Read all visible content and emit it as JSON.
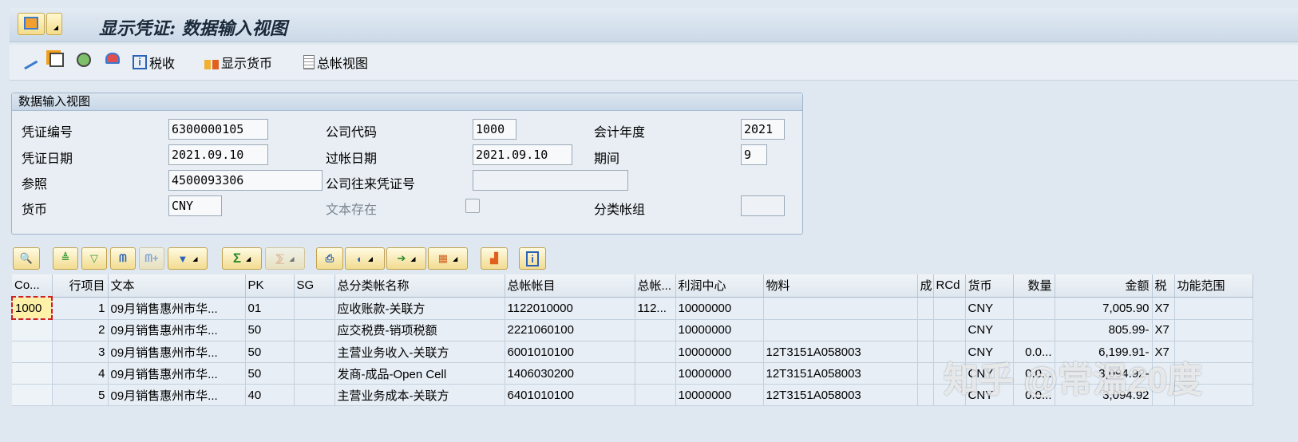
{
  "title": "显示凭证: 数据输入视图",
  "toolbar": {
    "tax": "税收",
    "display_currency": "显示货币",
    "gl_view": "总帐视图"
  },
  "panel": {
    "header": "数据输入视图",
    "doc_no_label": "凭证编号",
    "doc_no": "6300000105",
    "company_label": "公司代码",
    "company": "1000",
    "fiscal_year_label": "会计年度",
    "fiscal_year": "2021",
    "doc_date_label": "凭证日期",
    "doc_date": "2021.09.10",
    "post_date_label": "过帐日期",
    "post_date": "2021.09.10",
    "period_label": "期间",
    "period": "9",
    "ref_label": "参照",
    "ref": "4500093306",
    "intercompany_label": "公司往来凭证号",
    "intercompany": "",
    "currency_label": "货币",
    "currency": "CNY",
    "text_exists_label": "文本存在",
    "ledger_group_label": "分类帐组",
    "ledger_group": ""
  },
  "grid": {
    "columns": [
      "Co...",
      "行项目",
      "文本",
      "PK",
      "SG",
      "总分类帐名称",
      "总帐帐目",
      "总帐...",
      "利润中心",
      "物料",
      "成",
      "RCd",
      "货币",
      "数量",
      "金额",
      "税",
      "功能范围"
    ],
    "rows": [
      [
        "1000",
        "1",
        "09月销售惠州市华...",
        "01",
        "",
        "应收账款-关联方",
        "1122010000",
        "112...",
        "10000000",
        "",
        "",
        "",
        "CNY",
        "",
        "7,005.90",
        "X7",
        ""
      ],
      [
        "",
        "2",
        "09月销售惠州市华...",
        "50",
        "",
        "应交税费-销项税额",
        "2221060100",
        "",
        "10000000",
        "",
        "",
        "",
        "CNY",
        "",
        "805.99-",
        "X7",
        ""
      ],
      [
        "",
        "3",
        "09月销售惠州市华...",
        "50",
        "",
        "主营业务收入-关联方",
        "6001010100",
        "",
        "10000000",
        "12T3151A058003",
        "",
        "",
        "CNY",
        "0.0...",
        "6,199.91-",
        "X7",
        ""
      ],
      [
        "",
        "4",
        "09月销售惠州市华...",
        "50",
        "",
        "发商-成品-Open Cell",
        "1406030200",
        "",
        "10000000",
        "12T3151A058003",
        "",
        "",
        "CNY",
        "0.0...",
        "3,094.92-",
        "",
        ""
      ],
      [
        "",
        "5",
        "09月销售惠州市华...",
        "40",
        "",
        "主营业务成本-关联方",
        "6401010100",
        "",
        "10000000",
        "12T3151A058003",
        "",
        "",
        "CNY",
        "0.0...",
        "3,094.92",
        "",
        ""
      ]
    ]
  },
  "watermark": "知乎 @常温20度"
}
